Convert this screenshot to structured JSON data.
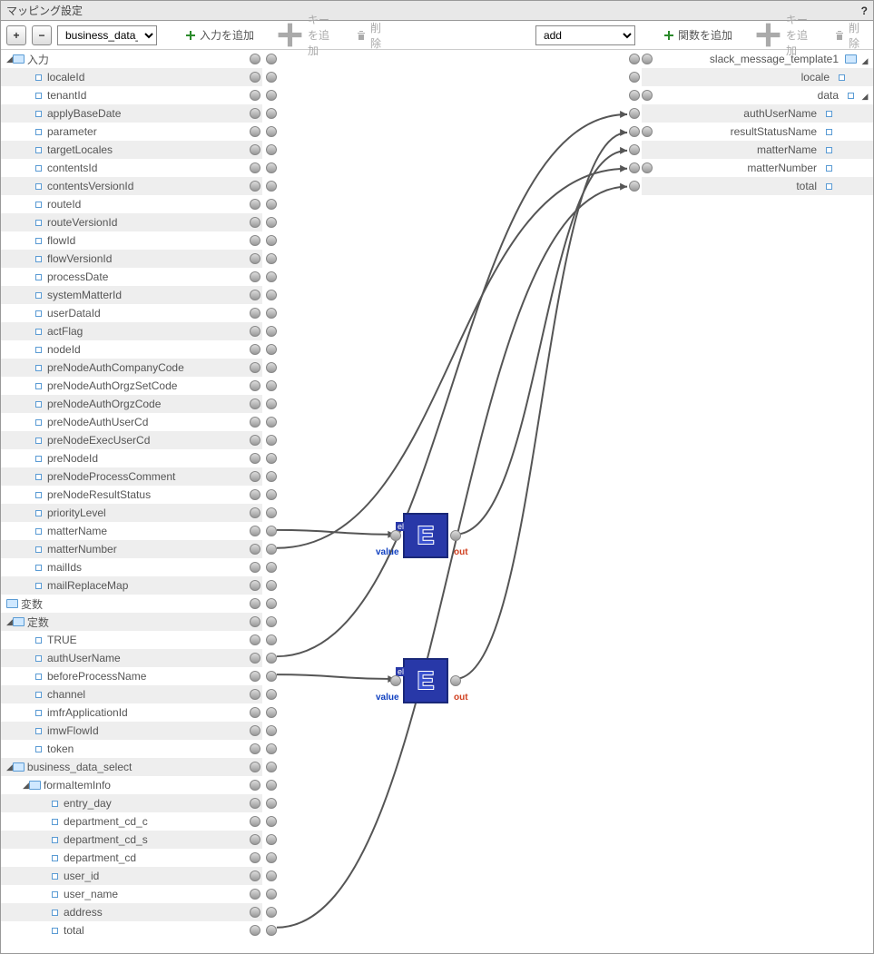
{
  "title": "マッピング設定",
  "help": "?",
  "toolbar": {
    "plus": "+",
    "minus": "−",
    "leftSelect": "business_data_se",
    "addInput": "入力を追加",
    "addKey": "キーを追加",
    "delete": "削除",
    "rightSelect": "add",
    "addFunc": "関数を追加",
    "addKey2": "キーを追加",
    "delete2": "削除"
  },
  "left": [
    {
      "d": 0,
      "t": "tri",
      "o": true,
      "ic": "f",
      "n": "入力",
      "ty": "<object>"
    },
    {
      "d": 1,
      "ic": "l",
      "n": "localeId",
      "ty": "<string>"
    },
    {
      "d": 1,
      "ic": "l",
      "n": "tenantId",
      "ty": "<string>"
    },
    {
      "d": 1,
      "ic": "l",
      "n": "applyBaseDate",
      "ty": "<string>"
    },
    {
      "d": 1,
      "ic": "l",
      "n": "parameter",
      "ty": "<string>"
    },
    {
      "d": 1,
      "ic": "l",
      "n": "targetLocales",
      "ty": "<string[]>"
    },
    {
      "d": 1,
      "ic": "l",
      "n": "contentsId",
      "ty": "<string>"
    },
    {
      "d": 1,
      "ic": "l",
      "n": "contentsVersionId",
      "ty": "<string>"
    },
    {
      "d": 1,
      "ic": "l",
      "n": "routeId",
      "ty": "<string>"
    },
    {
      "d": 1,
      "ic": "l",
      "n": "routeVersionId",
      "ty": "<string>"
    },
    {
      "d": 1,
      "ic": "l",
      "n": "flowId",
      "ty": "<string>"
    },
    {
      "d": 1,
      "ic": "l",
      "n": "flowVersionId",
      "ty": "<string>"
    },
    {
      "d": 1,
      "ic": "l",
      "n": "processDate",
      "ty": "<string>"
    },
    {
      "d": 1,
      "ic": "l",
      "n": "systemMatterId",
      "ty": "<string>"
    },
    {
      "d": 1,
      "ic": "l",
      "n": "userDataId",
      "ty": "<string>"
    },
    {
      "d": 1,
      "ic": "l",
      "n": "actFlag",
      "ty": "<string>"
    },
    {
      "d": 1,
      "ic": "l",
      "n": "nodeId",
      "ty": "<string>"
    },
    {
      "d": 1,
      "ic": "l",
      "n": "preNodeAuthCompanyCode",
      "ty": "<string>"
    },
    {
      "d": 1,
      "ic": "l",
      "n": "preNodeAuthOrgzSetCode",
      "ty": "<string>"
    },
    {
      "d": 1,
      "ic": "l",
      "n": "preNodeAuthOrgzCode",
      "ty": "<string>"
    },
    {
      "d": 1,
      "ic": "l",
      "n": "preNodeAuthUserCd",
      "ty": "<string>"
    },
    {
      "d": 1,
      "ic": "l",
      "n": "preNodeExecUserCd",
      "ty": "<string>"
    },
    {
      "d": 1,
      "ic": "l",
      "n": "preNodeId",
      "ty": "<string>"
    },
    {
      "d": 1,
      "ic": "l",
      "n": "preNodeProcessComment",
      "ty": "<string>"
    },
    {
      "d": 1,
      "ic": "l",
      "n": "preNodeResultStatus",
      "ty": "<string>"
    },
    {
      "d": 1,
      "ic": "l",
      "n": "priorityLevel",
      "ty": "<string>"
    },
    {
      "d": 1,
      "ic": "l",
      "n": "matterName",
      "ty": "<string>"
    },
    {
      "d": 1,
      "ic": "l",
      "n": "matterNumber",
      "ty": "<string>"
    },
    {
      "d": 1,
      "ic": "l",
      "n": "mailIds",
      "ty": "<string[]>"
    },
    {
      "d": 1,
      "ic": "l",
      "n": "mailReplaceMap",
      "ty": "<map>"
    },
    {
      "d": 0,
      "ic": "f",
      "n": "変数",
      "ty": "<object>"
    },
    {
      "d": 0,
      "t": "tri",
      "o": true,
      "ic": "f",
      "n": "定数",
      "ty": "<object>"
    },
    {
      "d": 1,
      "ic": "l",
      "n": "TRUE",
      "ty": "<string>"
    },
    {
      "d": 1,
      "ic": "l",
      "n": "authUserName",
      "ty": "<string>"
    },
    {
      "d": 1,
      "ic": "l",
      "n": "beforeProcessName",
      "ty": "<string>"
    },
    {
      "d": 1,
      "ic": "l",
      "n": "channel",
      "ty": "<string>"
    },
    {
      "d": 1,
      "ic": "l",
      "n": "imfrApplicationId",
      "ty": "<string>"
    },
    {
      "d": 1,
      "ic": "l",
      "n": "imwFlowId",
      "ty": "<string>"
    },
    {
      "d": 1,
      "ic": "l",
      "n": "token",
      "ty": "<string>"
    },
    {
      "d": 0,
      "t": "tri",
      "o": true,
      "ic": "f",
      "n": "business_data_select",
      "ty": "<object>"
    },
    {
      "d": 1,
      "t": "tri",
      "o": true,
      "ic": "f",
      "n": "formaItemInfo",
      "ty": "<object>"
    },
    {
      "d": 2,
      "ic": "l",
      "n": "entry_day",
      "ty": "<string>"
    },
    {
      "d": 2,
      "ic": "l",
      "n": "department_cd_c",
      "ty": "<string>"
    },
    {
      "d": 2,
      "ic": "l",
      "n": "department_cd_s",
      "ty": "<string>"
    },
    {
      "d": 2,
      "ic": "l",
      "n": "department_cd",
      "ty": "<string>"
    },
    {
      "d": 2,
      "ic": "l",
      "n": "user_id",
      "ty": "<string>"
    },
    {
      "d": 2,
      "ic": "l",
      "n": "user_name",
      "ty": "<string>"
    },
    {
      "d": 2,
      "ic": "l",
      "n": "address",
      "ty": "<string>"
    },
    {
      "d": 2,
      "ic": "l",
      "n": "total",
      "ty": "<bigdecimal>"
    }
  ],
  "right": [
    {
      "d": 0,
      "t": "tri",
      "o": true,
      "ic": "f",
      "n": "slack_message_template1",
      "ty": "<object>"
    },
    {
      "d": 1,
      "ic": "l",
      "n": "locale",
      "ty": "<locale>"
    },
    {
      "d": 1,
      "t": "tri",
      "o": true,
      "ic": "l",
      "n": "data",
      "ty": "<object>"
    },
    {
      "d": 2,
      "ic": "l",
      "n": "authUserName",
      "ty": "<string>"
    },
    {
      "d": 2,
      "ic": "l",
      "n": "resultStatusName",
      "ty": "<string>"
    },
    {
      "d": 2,
      "ic": "l",
      "n": "matterName",
      "ty": "<string>"
    },
    {
      "d": 2,
      "ic": "l",
      "n": "matterNumber",
      "ty": "<string>"
    },
    {
      "d": 2,
      "ic": "l",
      "n": "total",
      "ty": "<integer>"
    }
  ],
  "fn": {
    "valueLabel": "value",
    "outLabel": "out",
    "el": "el",
    "E": "E"
  }
}
